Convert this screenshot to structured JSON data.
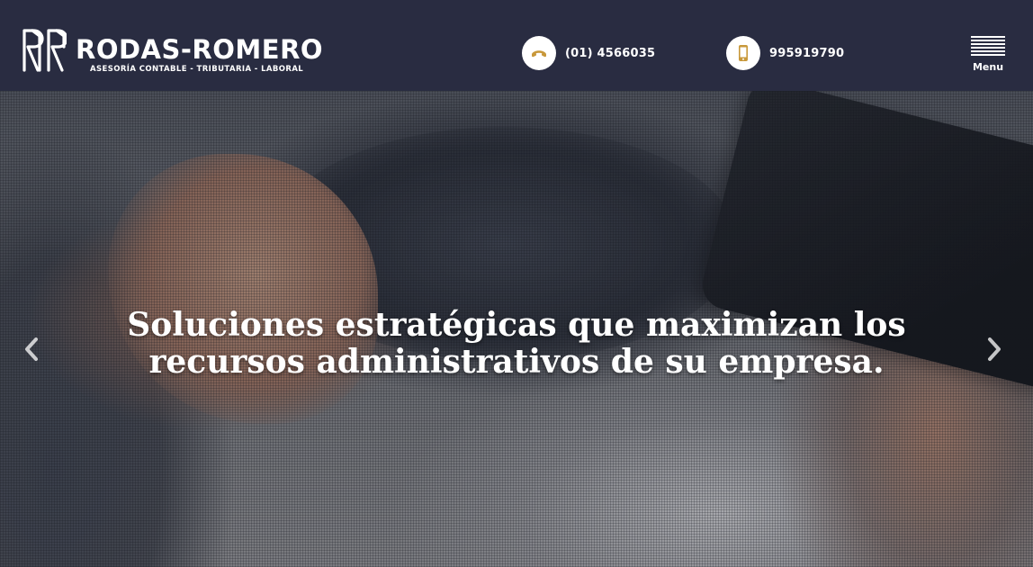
{
  "header": {
    "brand": {
      "name": "RODAS-ROMERO",
      "tagline": "ASESORÍA CONTABLE - TRIBUTARIA - LABORAL",
      "icon": "rr-monogram-logo"
    },
    "contacts": [
      {
        "icon": "phone-icon",
        "number": "(01) 4566035"
      },
      {
        "icon": "mobile-phone-icon",
        "number": "995919790"
      }
    ],
    "menu": {
      "label": "Menu",
      "icon": "hamburger-icon"
    }
  },
  "hero": {
    "headline_line1": "Soluciones estratégicas que maximizan los",
    "headline_line2": "recursos administrativos de su empresa.",
    "prev_icon": "chevron-left-icon",
    "next_icon": "chevron-right-icon"
  },
  "colors": {
    "header_bg": "#292c41",
    "accent": "#c8983a",
    "text_light": "#ffffff"
  }
}
